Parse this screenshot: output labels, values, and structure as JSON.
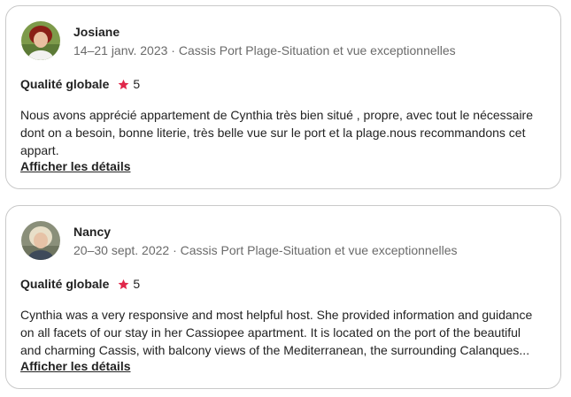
{
  "reviews": [
    {
      "name": "Josiane",
      "meta": "14–21 janv. 2023 · Cassis Port Plage-Situation et vue exceptionnelles",
      "rating_label": "Qualité globale",
      "rating_value": "5",
      "text_lines": [
        "Nous avons apprécié appartement de Cynthia très bien situé , propre, avec tout le nécessaire",
        "dont on a besoin, bonne literie, très belle vue sur le port et la plage.nous recommandons cet",
        "appart."
      ],
      "details_link": "Afficher les détails"
    },
    {
      "name": "Nancy",
      "meta": "20–30 sept. 2022 · Cassis Port Plage-Situation et vue exceptionnelles",
      "rating_label": "Qualité globale",
      "rating_value": "5",
      "text_lines": [
        "Cynthia was a very responsive and most helpful host. She provided information and guidance",
        "on all facets of our stay in her Cassiopee apartment. It is located on the port of the beautiful",
        "and charming Cassis, with balcony views of the Mediterranean, the surrounding Calanques..."
      ],
      "details_link": "Afficher les détails"
    }
  ],
  "colors": {
    "star": "#e0274a",
    "border": "#c9c9c9",
    "meta": "#6a6a6a"
  }
}
